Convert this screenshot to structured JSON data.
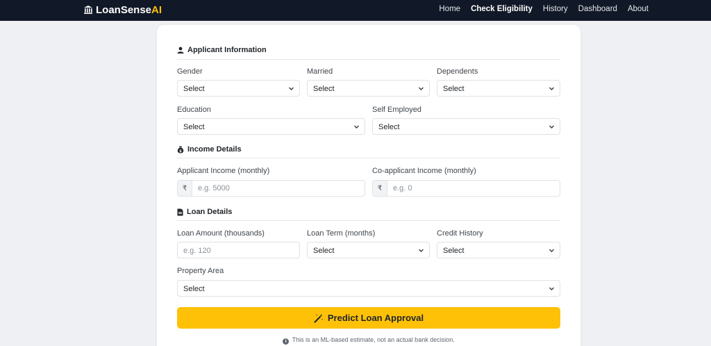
{
  "nav": {
    "brand": {
      "main": "LoanSense",
      "accent": "AI",
      "icon": "bank-icon"
    },
    "links": [
      "Home",
      "Check Eligibility",
      "History",
      "Dashboard",
      "About"
    ],
    "active_link": "Check Eligibility"
  },
  "form": {
    "applicant": {
      "title": "Applicant Information",
      "icon": "user-icon",
      "gender": {
        "label": "Gender",
        "value": "Select"
      },
      "married": {
        "label": "Married",
        "value": "Select"
      },
      "dependents": {
        "label": "Dependents",
        "value": "Select"
      },
      "education": {
        "label": "Education",
        "value": "Select"
      },
      "self_employed": {
        "label": "Self Employed",
        "value": "Select"
      }
    },
    "income": {
      "title": "Income Details",
      "icon": "money-bag-icon",
      "applicant_income": {
        "label": "Applicant Income (monthly)",
        "prefix": "₹",
        "placeholder": "e.g. 5000"
      },
      "coapplicant_income": {
        "label": "Co-applicant Income (monthly)",
        "prefix": "₹",
        "placeholder": "e.g. 0"
      }
    },
    "loan": {
      "title": "Loan Details",
      "icon": "document-icon",
      "amount": {
        "label": "Loan Amount (thousands)",
        "placeholder": "e.g. 120"
      },
      "term": {
        "label": "Loan Term (months)",
        "value": "Select"
      },
      "credit_history": {
        "label": "Credit History",
        "value": "Select"
      },
      "property_area": {
        "label": "Property Area",
        "value": "Select"
      }
    },
    "submit": {
      "label": "Predict Loan Approval",
      "icon": "magic-wand-icon"
    },
    "disclaimer": "This is an ML-based estimate, not an actual bank decision."
  },
  "colors": {
    "navbar": "#111827",
    "accent": "#ffc107",
    "background": "#eef0f3"
  }
}
